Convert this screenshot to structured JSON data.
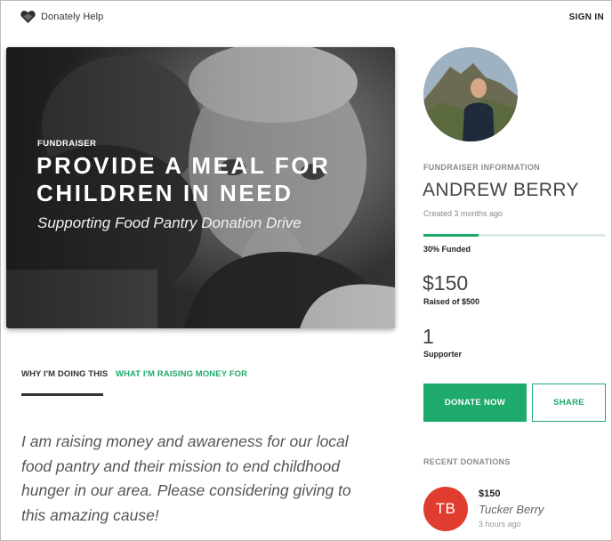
{
  "header": {
    "brand": "Donately Help",
    "sign_in": "SIGN IN"
  },
  "hero": {
    "kicker": "FUNDRAISER",
    "title": "PROVIDE A MEAL FOR CHILDREN IN NEED",
    "subtitle": "Supporting Food Pantry Donation Drive"
  },
  "tabs": [
    {
      "label": "WHY I'M DOING THIS",
      "active": true
    },
    {
      "label": "WHAT I'M RAISING MONEY FOR",
      "active": false
    }
  ],
  "story": "I am raising money and awareness for our local food pantry and their mission to end childhood hunger in our area. Please considering giving to this amazing cause!",
  "sidebar": {
    "info_label": "FUNDRAISER INFORMATION",
    "owner": "ANDREW BERRY",
    "created": "Created 3 months ago",
    "progress_fraction": 0.3,
    "funded_text": "30% Funded",
    "raised_amount": "$150",
    "raised_of": "Raised of $500",
    "supporter_count": "1",
    "supporter_label": "Supporter",
    "donate_label": "DONATE NOW",
    "share_label": "SHARE",
    "recent_label": "RECENT DONATIONS"
  },
  "donations": [
    {
      "initials": "TB",
      "amount": "$150",
      "name": "Tucker Berry",
      "time": "3 hours ago"
    }
  ],
  "colors": {
    "accent": "#1eaa6b",
    "donor_avatar": "#e03c2f",
    "text_dark": "#333333"
  },
  "icons": {
    "logo": "heart-logo-icon"
  }
}
